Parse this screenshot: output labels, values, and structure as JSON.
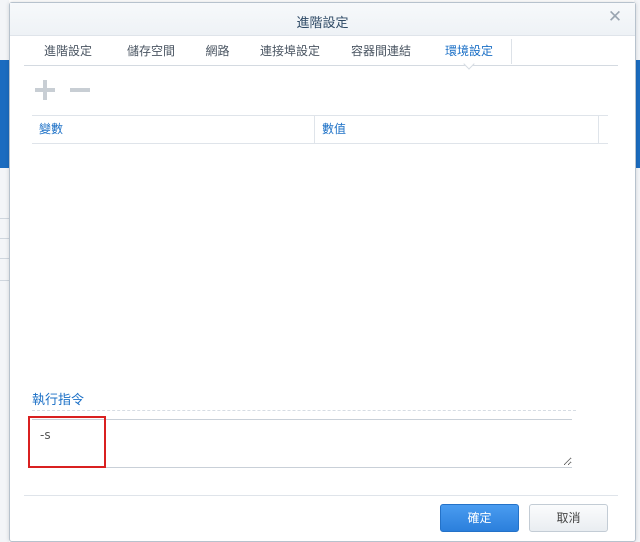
{
  "dialog": {
    "title": "進階設定",
    "close_icon": "close-icon"
  },
  "tabs": [
    {
      "label": "進階設定"
    },
    {
      "label": "儲存空間"
    },
    {
      "label": "網路"
    },
    {
      "label": "連接埠設定"
    },
    {
      "label": "容器間連結"
    },
    {
      "label": "環境設定",
      "active": true
    }
  ],
  "toolbar": {
    "add_icon": "plus-icon",
    "remove_icon": "minus-icon"
  },
  "env_table": {
    "columns": [
      "變數",
      "數值"
    ],
    "rows": []
  },
  "command": {
    "section_label": "執行指令",
    "value": "-s"
  },
  "footer": {
    "ok_label": "確定",
    "cancel_label": "取消"
  },
  "colors": {
    "accent": "#1a6fc6",
    "primary_button": "#2b7fdc",
    "highlight_box": "#d92020"
  }
}
